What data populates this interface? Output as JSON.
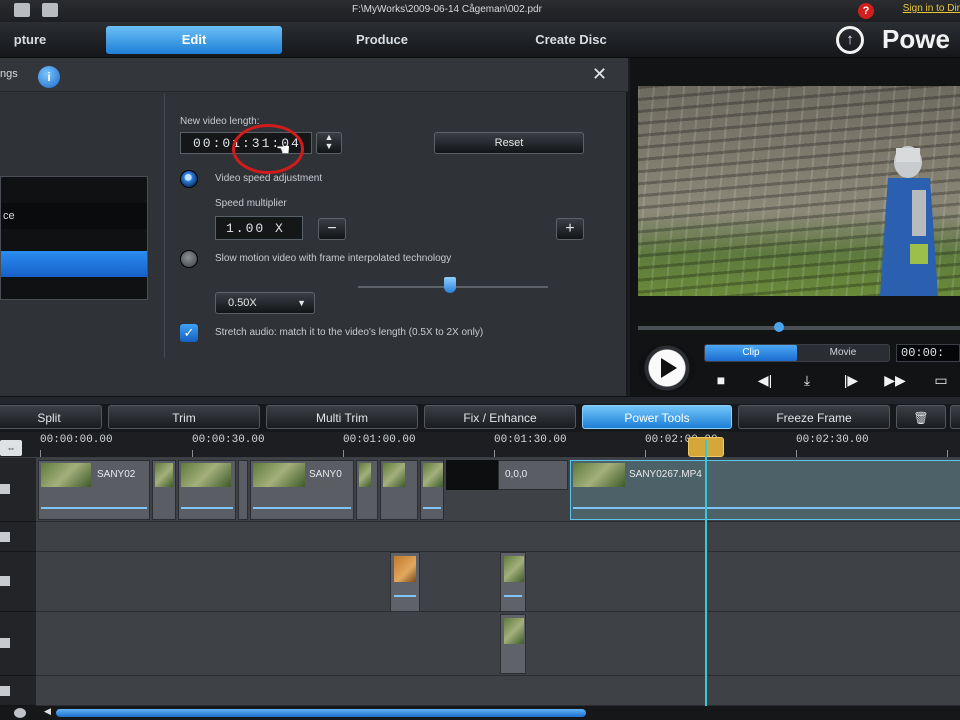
{
  "titlebar": {
    "path": "F:\\MyWorks\\2009-06-14 Cågeman\\002.pdr",
    "signin": "Sign in to Dir",
    "help": "?"
  },
  "main_tabs": [
    {
      "label": "pture",
      "active": false
    },
    {
      "label": "Edit",
      "active": true
    },
    {
      "label": "Produce",
      "active": false
    },
    {
      "label": "Create Disc",
      "active": false
    }
  ],
  "brand": {
    "name": "Powe"
  },
  "settings": {
    "title": "ngs",
    "info": "i",
    "close": "✕",
    "mode_list": [
      {
        "label": "",
        "selected": false
      },
      {
        "label": "ce",
        "selected": false
      },
      {
        "label": "",
        "selected": false
      },
      {
        "label": "",
        "selected": true
      },
      {
        "label": "",
        "selected": false
      }
    ],
    "new_length_label": "New video length:",
    "new_length_value": "00:01:31:04",
    "reset_label": "Reset",
    "speed_adjust_label": "Video speed adjustment",
    "speed_multiplier_label": "Speed multiplier",
    "speed_value": "1.00 X",
    "slow_motion_label": "Slow motion video with frame interpolated technology",
    "slow_motion_select": "0.50X",
    "stretch_audio_label": "Stretch audio: match it to the video's length (0.5X to 2X only)",
    "speed_level": 0.45
  },
  "preview": {
    "clip_label": "Clip",
    "movie_label": "Movie",
    "timecode": "00:00:",
    "scrub_position": 0.44
  },
  "functions": [
    {
      "label": "Split",
      "active": false
    },
    {
      "label": "Trim",
      "active": false
    },
    {
      "label": "Multi Trim",
      "active": false
    },
    {
      "label": "Fix / Enhance",
      "active": false
    },
    {
      "label": "Power Tools",
      "active": true
    },
    {
      "label": "Freeze Frame",
      "active": false
    }
  ],
  "ruler": {
    "ticks": [
      "00:00:00.00",
      "00:00:30.00",
      "00:01:00.00",
      "00:01:30.00",
      "00:02:00.00",
      "00:02:30.00"
    ]
  },
  "tracks": {
    "video_clips": [
      {
        "name": "SANY02"
      },
      {
        "name": ""
      },
      {
        "name": ""
      },
      {
        "name": "SANY0"
      },
      {
        "name": ""
      },
      {
        "name": ""
      },
      {
        "name": ""
      },
      {
        "name": "0,0,0"
      },
      {
        "name": "SANY0267.MP4"
      }
    ]
  },
  "colors": {
    "accent": "#1e7fd6",
    "playhead": "#36c8d8",
    "highlight_circle": "#d21c1c"
  }
}
